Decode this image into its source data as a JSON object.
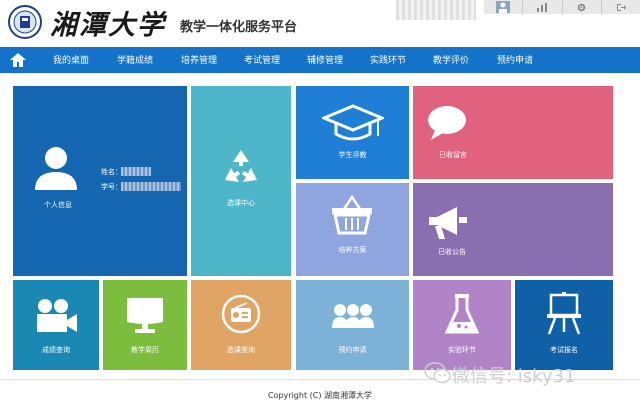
{
  "header": {
    "logo_text": "湘潭大学",
    "platform_title": "教学一体化服务平台"
  },
  "nav": {
    "items": [
      "我的桌面",
      "学籍成绩",
      "培养管理",
      "考试管理",
      "辅修管理",
      "实践环节",
      "教学评价",
      "预约申请"
    ]
  },
  "tiles": {
    "personal": {
      "label": "个人信息",
      "name_label": "姓名：",
      "id_label": "学号："
    },
    "select_center": {
      "label": "选课中心"
    },
    "student_eval": {
      "label": "学生评教"
    },
    "messages": {
      "label": "已收留言"
    },
    "training_plan": {
      "label": "培养方案"
    },
    "notices": {
      "label": "已收公告"
    },
    "grades": {
      "label": "成绩查询"
    },
    "calendar": {
      "label": "教学周历"
    },
    "rating": {
      "label": "选课查询"
    },
    "appointment": {
      "label": "预约申请"
    },
    "practice": {
      "label": "实验环节"
    },
    "exam_signup": {
      "label": "考试报名"
    }
  },
  "colors": {
    "nav": "#1473c9",
    "personal": "#1466b0",
    "select_center": "#4db6c9",
    "student_eval": "#1f7fd6",
    "messages": "#e0627f",
    "training_plan": "#8ea5e0",
    "notices": "#8a6fb0",
    "grades": "#1b87b3",
    "calendar": "#7cbd3d",
    "rating": "#e0a564",
    "appointment": "#7cb2d8",
    "practice": "#b084c7",
    "exam_signup": "#1060a8"
  },
  "footer": {
    "copyright": "Copyright (C) 湖南湘潭大学"
  },
  "watermark": {
    "text": "微信号: isky31"
  }
}
